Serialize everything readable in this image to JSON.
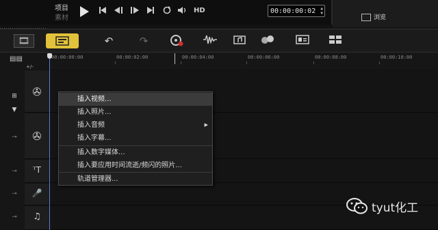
{
  "player": {
    "mode_project": "项目",
    "mode_clip": "素材",
    "timecode": "00:00:00:02",
    "hd_label": "HD",
    "icons": [
      "play-icon",
      "skip-start-icon",
      "prev-frame-icon",
      "next-frame-icon",
      "skip-end-icon",
      "repeat-icon",
      "volume-icon"
    ]
  },
  "right_panel": {
    "browse_label": "浏览"
  },
  "toolbar": {
    "storyboard_icon": "filmstrip-icon",
    "timeline_icon": "timeline-view-icon",
    "undo_icon": "undo-icon",
    "redo_icon": "redo-icon",
    "record_icon": "record-capture-icon",
    "audio_mix_icon": "sound-mixer-icon",
    "auto_music_icon": "auto-music-icon",
    "motion_icon": "motion-tracking-icon",
    "subtitle_icon": "subtitle-editor-icon",
    "multitrim_icon": "multi-trim-icon"
  },
  "ruler": {
    "labels": [
      "00:00:00:00",
      "00:00:02:00",
      "00:00:04:00",
      "00:00:06:00",
      "00:00:08:00",
      "00:00:10:00"
    ],
    "zoom_label": "+/-"
  },
  "tracks": [
    {
      "name": "video",
      "icon": "film-reel-icon"
    },
    {
      "name": "overlay",
      "icon": "film-reel-icon"
    },
    {
      "name": "title",
      "icon": "title-t-icon"
    },
    {
      "name": "voice",
      "icon": "microphone-icon"
    },
    {
      "name": "music",
      "icon": "music-note-icon"
    }
  ],
  "context_menu": {
    "items": [
      {
        "label": "插入视频...",
        "highlighted": true
      },
      {
        "label": "插入照片..."
      },
      {
        "label": "插入音频",
        "submenu": true
      },
      {
        "label": "插入字幕..."
      },
      {
        "label": "插入数字媒体..."
      },
      {
        "label": "插入要应用时间流逝/频闪的照片..."
      },
      {
        "label": "轨道管理器..."
      }
    ]
  },
  "watermark": {
    "text": "tyut化工"
  }
}
